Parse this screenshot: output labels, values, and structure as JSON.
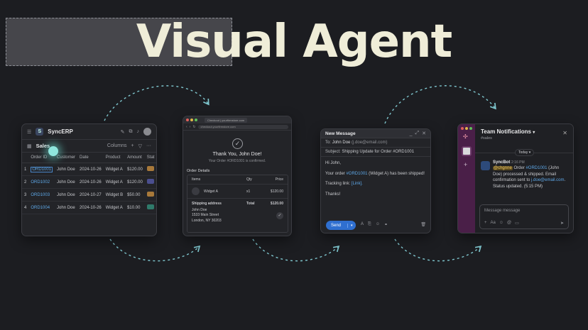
{
  "headline": "Visual Agent",
  "erp": {
    "app_name": "SyncERP",
    "logo_letter": "S",
    "section_title": "Sales",
    "columns_button": "Columns",
    "headers": [
      "",
      "Order ID",
      "Customer",
      "Date",
      "Product",
      "Amount",
      "Stat"
    ],
    "rows": [
      {
        "n": "1",
        "id": "ORD1001",
        "customer": "John Doe",
        "date": "2024-10-26",
        "product": "Widget A",
        "amount": "$120.00",
        "status_color": "#a8793a"
      },
      {
        "n": "2",
        "id": "ORD1002",
        "customer": "John Doe",
        "date": "2024-10-26",
        "product": "Widget A",
        "amount": "$120.00",
        "status_color": "#4b4f8f"
      },
      {
        "n": "3",
        "id": "ORD1003",
        "customer": "John Doe",
        "date": "2024-10-27",
        "product": "Widget B",
        "amount": "$50.00",
        "status_color": "#a8793a"
      },
      {
        "n": "4",
        "id": "ORD1004",
        "customer": "John Doe",
        "date": "2024-10-26",
        "product": "Widget A",
        "amount": "$10.00",
        "status_color": "#2f7a6a"
      }
    ]
  },
  "browser": {
    "tab_title": "Checkout | yourfirmstore.com",
    "url": "checkout.yourfirmstore.com",
    "thanks": "Thank You, John Doe!",
    "confirmed": "Your Order #ORD1001 is confirmed.",
    "order_details_label": "Order Details",
    "col_items": "Items",
    "col_qty": "Qty",
    "col_price": "Price",
    "item_name": "Widget A",
    "item_qty": "x1",
    "item_price": "$120.00",
    "shipping_label": "Shipping address",
    "total_label": "Total",
    "total_value": "$120.00",
    "address_name": "John Doe",
    "address_street": "1533 Main Street",
    "address_city": "London, NY 30203"
  },
  "email": {
    "window_title": "New Message",
    "to_label": "To:",
    "to_value": "John Doe",
    "to_email": "(j.doe@email.com)",
    "subject_label": "Subject:",
    "subject_value": "Shipping Update for Order #ORD1001",
    "greeting": "Hi John,",
    "body_pre": "Your order ",
    "body_order": "#ORD1001",
    "body_post": " (Widget A) has been shipped!",
    "tracking_label": "Tracking link: ",
    "tracking_link": "[Link].",
    "signoff": "Thanks!",
    "send_label": "Send"
  },
  "slack": {
    "title": "Team Notifications",
    "channel": "#sales",
    "today": "Today",
    "bot_name": "SyncBot",
    "time": "2:16 PM",
    "mention": "@chgnne",
    "msg_a": " Order ",
    "msg_order": "#ORD1001",
    "msg_b": " (John Doe) processed & shipped. Email confirmation sent to ",
    "msg_email": "j.doe@email.com",
    "msg_c": ". Status updated.",
    "msg_time": "(5:15 PM)",
    "input_placeholder": "Message message"
  },
  "colors": {
    "accent_blue": "#2f6fd0",
    "link": "#5ea8e8",
    "headline": "#efedd8",
    "arrow": "#7fc7cf",
    "slack_rail": "#4a1f48"
  }
}
